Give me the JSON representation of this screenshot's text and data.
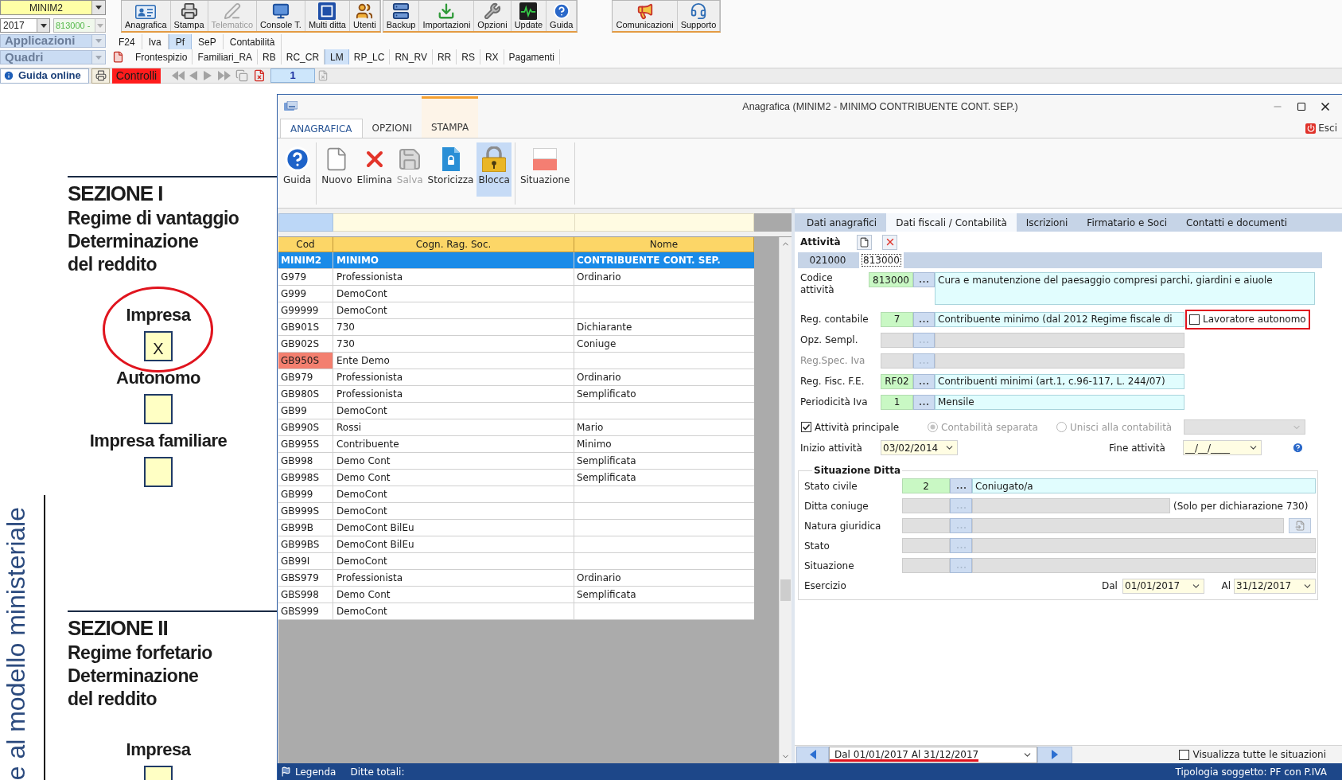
{
  "top": {
    "company": "MINIM2",
    "year": "2017",
    "activity": "813000 -",
    "applications": "Applicazioni",
    "sections": "Quadri"
  },
  "toolbar_groups": [
    {
      "buttons": [
        {
          "label": "Anagrafica",
          "disabled": false
        },
        {
          "label": "Stampa",
          "disabled": false
        },
        {
          "label": "Telematico",
          "disabled": true
        },
        {
          "label": "Console T.",
          "disabled": false
        },
        {
          "label": "Multi ditta",
          "disabled": false
        },
        {
          "label": "Utenti",
          "disabled": false
        }
      ]
    },
    {
      "buttons": [
        {
          "label": "Backup",
          "disabled": false
        },
        {
          "label": "Importazioni",
          "disabled": false
        },
        {
          "label": "Opzioni",
          "disabled": false
        },
        {
          "label": "Update",
          "disabled": false
        },
        {
          "label": "Guida",
          "disabled": false
        }
      ]
    },
    {
      "buttons": [
        {
          "label": "Comunicazioni",
          "disabled": false
        },
        {
          "label": "Supporto",
          "disabled": false
        }
      ]
    }
  ],
  "app_tabs": [
    {
      "label": "F24",
      "selected": false
    },
    {
      "label": "Iva",
      "selected": false
    },
    {
      "label": "Pf",
      "selected": true
    },
    {
      "label": "SeP",
      "selected": false
    },
    {
      "label": "Contabilità",
      "selected": false
    }
  ],
  "form_tabs": [
    {
      "label": "Frontespizio",
      "selected": false
    },
    {
      "label": "Familiari_RA",
      "selected": false
    },
    {
      "label": "RB",
      "selected": false
    },
    {
      "label": "RC_CR",
      "selected": false
    },
    {
      "label": "LM",
      "selected": true
    },
    {
      "label": "RP_LC",
      "selected": false
    },
    {
      "label": "RN_RV",
      "selected": false
    },
    {
      "label": "RR",
      "selected": false
    },
    {
      "label": "RS",
      "selected": false
    },
    {
      "label": "RX",
      "selected": false
    },
    {
      "label": "Pagamenti",
      "selected": false
    }
  ],
  "action_bar": {
    "help": "Guida online",
    "checks": "Controlli",
    "page": "1"
  },
  "document": {
    "side_text": "e al modello ministeriale",
    "sections": [
      {
        "title": "SEZIONE I",
        "subtitle": [
          "Regime di vantaggio",
          "Determinazione",
          "del reddito"
        ],
        "options": [
          {
            "label": "Impresa",
            "value": "X",
            "highlighted": true
          },
          {
            "label": "Autonomo",
            "highlighted": false
          },
          {
            "label": "Impresa familiare",
            "highlighted": false
          }
        ]
      },
      {
        "title": "SEZIONE II",
        "subtitle": [
          "Regime forfetario",
          "Determinazione",
          "del reddito"
        ],
        "options": [
          {
            "label": "Impresa",
            "highlighted": false
          }
        ]
      }
    ]
  },
  "dialog": {
    "title": "Anagrafica (MINIM2 - MINIMO CONTRIBUENTE CONT. SEP.)",
    "ribbon_tabs": [
      {
        "label": "ANAGRAFICA",
        "selected": true,
        "contextual": false
      },
      {
        "label": "OPZIONI",
        "selected": false,
        "contextual": false
      },
      {
        "label": "STAMPA",
        "selected": false,
        "contextual": true
      }
    ],
    "exit": "Esci",
    "ribbon_groups": [
      {
        "buttons": [
          {
            "label": "Guida",
            "disabled": false,
            "pressed": false
          }
        ]
      },
      {
        "buttons": [
          {
            "label": "Nuovo",
            "disabled": false,
            "pressed": false
          },
          {
            "label": "Elimina",
            "disabled": false,
            "pressed": false
          },
          {
            "label": "Salva",
            "disabled": true,
            "pressed": false
          },
          {
            "label": "Storicizza",
            "disabled": false,
            "pressed": false
          },
          {
            "label": "Blocca",
            "disabled": false,
            "pressed": true
          }
        ]
      },
      {
        "buttons": [
          {
            "label": "Situazione",
            "disabled": false,
            "pressed": false
          }
        ]
      }
    ],
    "list": {
      "columns": [
        "Cod",
        "Cogn. Rag. Soc.",
        "Nome"
      ],
      "rows": [
        {
          "cod": "MINIM2",
          "name": "MINIMO",
          "first_name": "CONTRIBUENTE CONT. SEP.",
          "selected": true,
          "flagged": false
        },
        {
          "cod": "G979",
          "name": "Professionista",
          "first_name": "Ordinario",
          "selected": false,
          "flagged": false
        },
        {
          "cod": "G999",
          "name": "DemoCont",
          "selected": false,
          "flagged": false
        },
        {
          "cod": "G99999",
          "name": "DemoCont",
          "selected": false,
          "flagged": false
        },
        {
          "cod": "GB901S",
          "name": "730",
          "first_name": "Dichiarante",
          "selected": false,
          "flagged": false
        },
        {
          "cod": "GB902S",
          "name": "730",
          "first_name": "Coniuge",
          "selected": false,
          "flagged": false
        },
        {
          "cod": "GB950S",
          "name": "Ente Demo",
          "selected": false,
          "flagged": true
        },
        {
          "cod": "GB979",
          "name": "Professionista",
          "first_name": "Ordinario",
          "selected": false,
          "flagged": false
        },
        {
          "cod": "GB980S",
          "name": "Professionista",
          "first_name": "Semplificato",
          "selected": false,
          "flagged": false
        },
        {
          "cod": "GB99",
          "name": "DemoCont",
          "selected": false,
          "flagged": false
        },
        {
          "cod": "GB990S",
          "name": "Rossi",
          "first_name": "Mario",
          "selected": false,
          "flagged": false
        },
        {
          "cod": "GB995S",
          "name": "Contribuente",
          "first_name": "Minimo",
          "selected": false,
          "flagged": false
        },
        {
          "cod": "GB998",
          "name": "Demo Cont",
          "first_name": "Semplificata",
          "selected": false,
          "flagged": false
        },
        {
          "cod": "GB998S",
          "name": "Demo Cont",
          "first_name": "Semplificata",
          "selected": false,
          "flagged": false
        },
        {
          "cod": "GB999",
          "name": "DemoCont",
          "selected": false,
          "flagged": false
        },
        {
          "cod": "GB999S",
          "name": "DemoCont",
          "selected": false,
          "flagged": false
        },
        {
          "cod": "GB99B",
          "name": "DemoCont BilEu",
          "selected": false,
          "flagged": false
        },
        {
          "cod": "GB99BS",
          "name": "DemoCont BilEu",
          "selected": false,
          "flagged": false
        },
        {
          "cod": "GB99I",
          "name": "DemoCont",
          "selected": false,
          "flagged": false
        },
        {
          "cod": "GBS979",
          "name": "Professionista",
          "first_name": "Ordinario",
          "selected": false,
          "flagged": false
        },
        {
          "cod": "GBS998",
          "name": "Demo Cont",
          "first_name": "Semplificata",
          "selected": false,
          "flagged": false
        },
        {
          "cod": "GBS999",
          "name": "DemoCont",
          "selected": false,
          "flagged": false
        }
      ]
    },
    "detail_tabs": [
      {
        "label": "Dati anagrafici",
        "selected": false
      },
      {
        "label": "Dati fiscali / Contabilità",
        "selected": true
      },
      {
        "label": "Iscrizioni",
        "selected": false
      },
      {
        "label": "Firmatario e Soci",
        "selected": false
      },
      {
        "label": "Contatti e documenti",
        "selected": false
      }
    ],
    "activity": {
      "label": "Attività",
      "codes": [
        {
          "label": "021000",
          "selected": false
        },
        {
          "label": "813000",
          "selected": true
        }
      ]
    },
    "fields": [
      {
        "kind": "multiline",
        "label": "Codice attività",
        "code": "813000",
        "description": "Cura e manutenzione del paesaggio compresi parchi, giardini e aiuole",
        "disabled": false
      },
      {
        "kind": "single",
        "label": "Reg. contabile",
        "code": "7",
        "description": "Contribuente minimo (dal 2012 Regime fiscale di",
        "disabled": false,
        "option": {
          "label": "Lavoratore autonomo",
          "checked": false,
          "highlighted": true
        }
      },
      {
        "kind": "single",
        "label": "Opz. Sempl.",
        "disabled": false
      },
      {
        "kind": "single",
        "label": "Reg.Spec. Iva",
        "disabled": true
      },
      {
        "kind": "single",
        "label": "Reg. Fisc. F.E.",
        "code": "RF02",
        "description": "Contribuenti minimi (art.1, c.96-117, L. 244/07)",
        "disabled": false
      },
      {
        "kind": "single",
        "label": "Periodicità Iva",
        "code": "1",
        "description": "Mensile",
        "disabled": false
      }
    ],
    "principal": {
      "label": "Attività principale",
      "checked": true
    },
    "accounting": {
      "disabled": true,
      "options": [
        {
          "label": "Contabilità separata",
          "selected": true
        },
        {
          "label": "Unisci alla contabilità",
          "selected": false
        }
      ]
    },
    "start": {
      "label": "Inizio attività",
      "value": "03/02/2014"
    },
    "end": {
      "label": "Fine attività",
      "value": "__/__/____"
    },
    "company_status": {
      "title": "Situazione Ditta",
      "fields": [
        {
          "kind": "plain",
          "label": "Stato civile",
          "code": "2",
          "description": "Coniugato/a"
        },
        {
          "kind": "note",
          "label": "Ditta coniuge",
          "note": "(Solo per dichiarazione 730)"
        },
        {
          "kind": "button",
          "label": "Natura giuridica"
        },
        {
          "kind": "plain",
          "label": "Stato"
        },
        {
          "kind": "plain",
          "label": "Situazione"
        }
      ],
      "period": {
        "label": "Esercizio",
        "from_label": "Dal",
        "from": "01/01/2017",
        "to_label": "Al",
        "to": "31/12/2017"
      }
    },
    "period_nav": {
      "value": "Dal 01/01/2017 Al 31/12/2017",
      "highlighted": true
    },
    "show_all": {
      "label": "Visualizza tutte le situazioni",
      "checked": false
    },
    "status_bar": {
      "legend": "Legenda",
      "total": "Ditte totali:",
      "type": "Tipologia soggetto: PF con P.IVA"
    }
  }
}
